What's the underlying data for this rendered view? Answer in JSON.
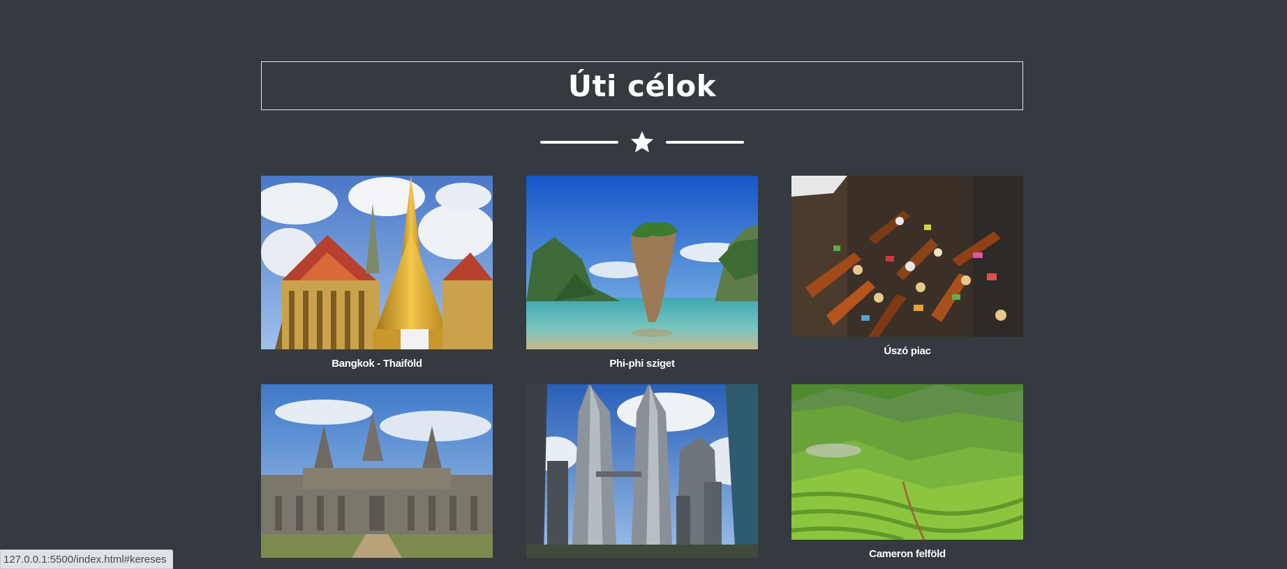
{
  "header": {
    "title": "Úti célok"
  },
  "divider": {
    "icon": "star-icon"
  },
  "destinations": [
    {
      "caption": "Bangkok - Thaiföld",
      "image": "temple-photo"
    },
    {
      "caption": "Phi-phi sziget",
      "image": "island-rock-photo"
    },
    {
      "caption": "Úszó piac",
      "image": "floating-market-photo"
    },
    {
      "caption": "",
      "image": "angkor-temple-photo"
    },
    {
      "caption": "",
      "image": "twin-towers-photo"
    },
    {
      "caption": "Cameron felföld",
      "image": "tea-hills-photo"
    }
  ],
  "status_bar": {
    "url": "127.0.0.1:5500/index.html#kereses"
  },
  "colors": {
    "background": "#343a40",
    "text": "#ffffff",
    "border": "#e8e8e8"
  }
}
